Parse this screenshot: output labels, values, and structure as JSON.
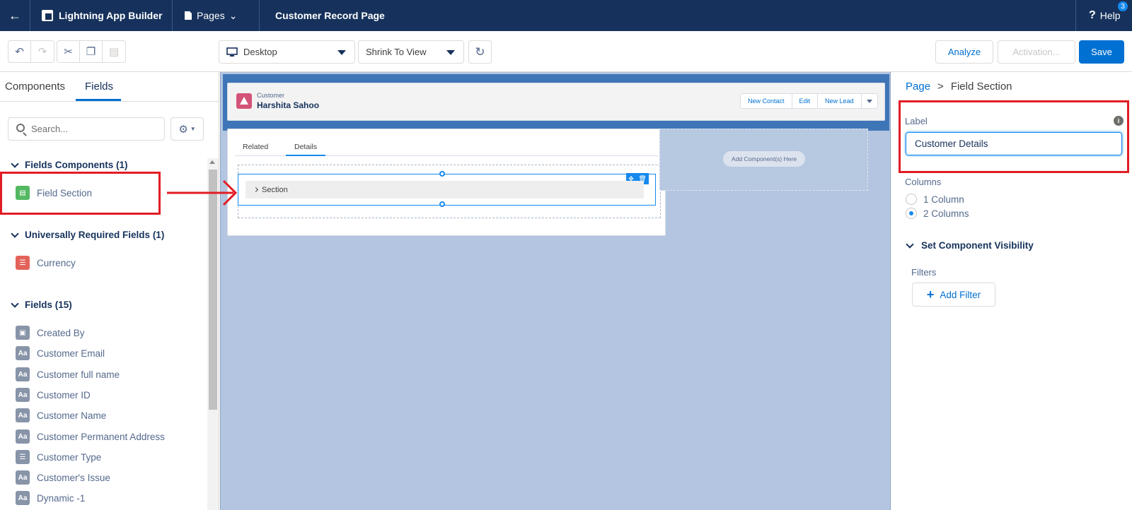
{
  "header": {
    "back_icon": "arrow-left-icon",
    "app_name": "Lightning App Builder",
    "pages_menu": "Pages",
    "page_title": "Customer Record Page",
    "help": "Help",
    "help_badge": "3"
  },
  "toolbar": {
    "device_select": "Desktop",
    "view_select": "Shrink To View",
    "analyze": "Analyze",
    "activation": "Activation...",
    "save": "Save"
  },
  "left_panel": {
    "tabs": [
      "Components",
      "Fields"
    ],
    "active_tab": "Fields",
    "search_placeholder": "Search...",
    "groups": [
      {
        "title": "Fields Components (1)",
        "items": [
          {
            "label": "Field Section",
            "icon": "field-section-icon"
          }
        ]
      },
      {
        "title": "Universally Required Fields (1)",
        "items": [
          {
            "label": "Currency",
            "icon": "picklist-icon"
          }
        ]
      },
      {
        "title": "Fields (15)",
        "items": [
          {
            "label": "Created By",
            "icon": "lookup-icon"
          },
          {
            "label": "Customer Email",
            "icon": "text-icon"
          },
          {
            "label": "Customer full name",
            "icon": "text-icon"
          },
          {
            "label": "Customer ID",
            "icon": "text-icon"
          },
          {
            "label": "Customer Name",
            "icon": "text-icon"
          },
          {
            "label": "Customer Permanent Address",
            "icon": "text-icon"
          },
          {
            "label": "Customer Type",
            "icon": "picklist-icon"
          },
          {
            "label": "Customer's Issue",
            "icon": "text-icon"
          },
          {
            "label": "Dynamic -1",
            "icon": "text-icon"
          }
        ]
      }
    ]
  },
  "canvas": {
    "record_object": "Customer",
    "record_name": "Harshita Sahoo",
    "actions": [
      "New Contact",
      "Edit",
      "New Lead"
    ],
    "tabs": [
      "Related",
      "Details"
    ],
    "active_tab": "Details",
    "section_label": "Section",
    "add_component": "Add Component(s) Here"
  },
  "right_panel": {
    "breadcrumb_root": "Page",
    "breadcrumb_sep": ">",
    "breadcrumb_current": "Field Section",
    "label_field_label": "Label",
    "label_value": "Customer Details",
    "columns_label": "Columns",
    "column_options": [
      "1 Column",
      "2 Columns"
    ],
    "selected_column": "2 Columns",
    "visibility_title": "Set Component Visibility",
    "filters_label": "Filters",
    "add_filter": "Add Filter"
  },
  "annotation_color": "#e11d24"
}
